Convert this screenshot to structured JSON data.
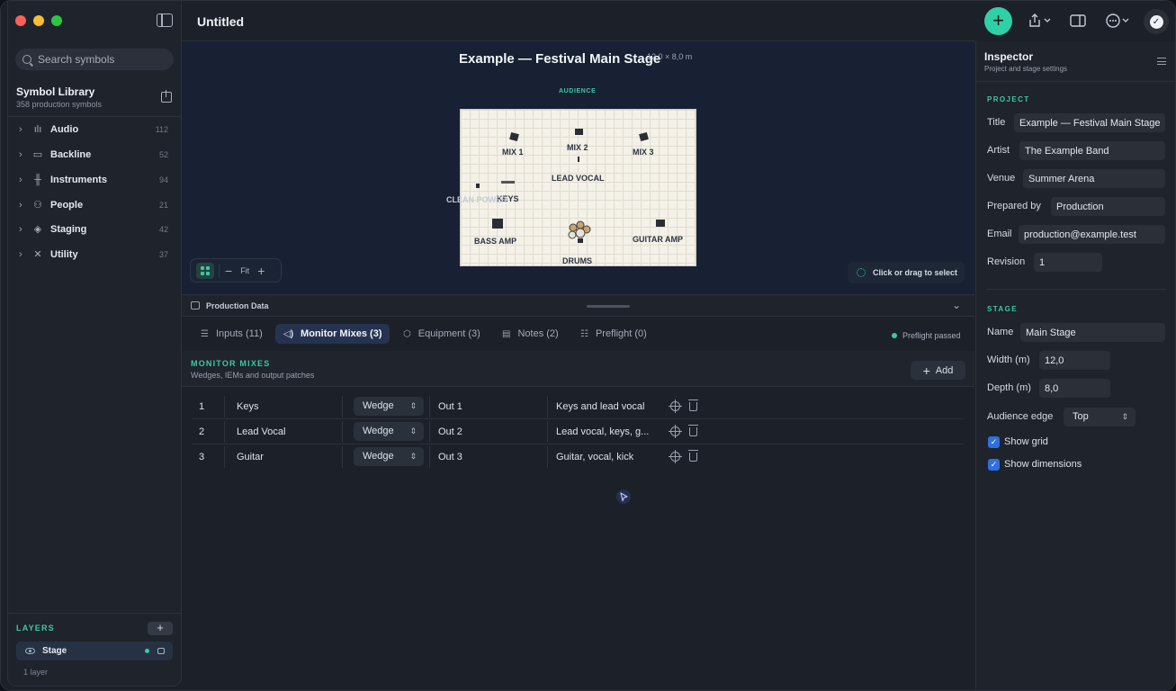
{
  "window": {
    "title": "Untitled"
  },
  "sidebar": {
    "search_placeholder": "Search symbols",
    "library_title": "Symbol Library",
    "library_subtitle": "358 production symbols",
    "categories": [
      {
        "label": "Audio",
        "count": "112",
        "icon": "audio-waveform-icon"
      },
      {
        "label": "Backline",
        "count": "52",
        "icon": "amp-icon"
      },
      {
        "label": "Instruments",
        "count": "94",
        "icon": "instruments-icon"
      },
      {
        "label": "People",
        "count": "21",
        "icon": "people-icon"
      },
      {
        "label": "Staging",
        "count": "42",
        "icon": "layers-icon"
      },
      {
        "label": "Utility",
        "count": "37",
        "icon": "tools-icon"
      }
    ],
    "layers_title": "LAYERS",
    "layers_add": "+",
    "layers": [
      {
        "name": "Stage"
      }
    ],
    "layer_count": "1 layer"
  },
  "canvas": {
    "stage_title": "Example — Festival Main Stage",
    "stage_dimensions": "12,0 × 8,0 m",
    "audience_label": "AUDIENCE",
    "symbols": {
      "mix1": "MIX 1",
      "mix2": "MIX 2",
      "mix3": "MIX 3",
      "lead_vocal": "LEAD VOCAL",
      "keys": "KEYS",
      "clean_power": "CLEAN POWER",
      "bass_amp": "BASS AMP",
      "guitar_amp": "GUITAR AMP",
      "drums": "DRUMS"
    },
    "zoom": {
      "minus": "−",
      "fit": "Fit",
      "plus": "+"
    },
    "select_hint": "Click or drag to select"
  },
  "production": {
    "panel_title": "Production Data",
    "tabs": [
      {
        "label": "Inputs (11)",
        "icon": "list-icon"
      },
      {
        "label": "Monitor Mixes (3)",
        "icon": "speaker-icon"
      },
      {
        "label": "Equipment (3)",
        "icon": "cube-icon"
      },
      {
        "label": "Notes (2)",
        "icon": "note-icon"
      },
      {
        "label": "Preflight (0)",
        "icon": "checklist-icon"
      }
    ],
    "active_tab": "Monitor Mixes (3)",
    "preflight_status": "Preflight passed",
    "section_title": "MONITOR MIXES",
    "section_subtitle": "Wedges, IEMs and output patches",
    "add_label": "Add",
    "rows": [
      {
        "num": "1",
        "name": "Keys",
        "type": "Wedge",
        "output": "Out 1",
        "mix": "Keys and lead vocal"
      },
      {
        "num": "2",
        "name": "Lead Vocal",
        "type": "Wedge",
        "output": "Out 2",
        "mix": "Lead vocal, keys, g..."
      },
      {
        "num": "3",
        "name": "Guitar",
        "type": "Wedge",
        "output": "Out 3",
        "mix": "Guitar, vocal, kick"
      }
    ]
  },
  "inspector": {
    "title": "Inspector",
    "subtitle": "Project and stage settings",
    "project_title": "PROJECT",
    "fields": {
      "title_label": "Title",
      "title_value": "Example — Festival Main Stage",
      "artist_label": "Artist",
      "artist_value": "The Example Band",
      "venue_label": "Venue",
      "venue_value": "Summer Arena",
      "prepared_label": "Prepared by",
      "prepared_value": "Production",
      "email_label": "Email",
      "email_value": "production@example.test",
      "revision_label": "Revision",
      "revision_value": "1"
    },
    "stage_title": "STAGE",
    "stage": {
      "name_label": "Name",
      "name_value": "Main Stage",
      "width_label": "Width (m)",
      "width_value": "12,0",
      "depth_label": "Depth (m)",
      "depth_value": "8,0",
      "audience_label": "Audience edge",
      "audience_value": "Top",
      "show_grid": "Show grid",
      "show_dimensions": "Show dimensions"
    }
  },
  "colors": {
    "accent": "#3ec7a4",
    "fab": "#2fd0a6",
    "checkbox": "#2f6fe0",
    "active_tab": "#263350"
  }
}
